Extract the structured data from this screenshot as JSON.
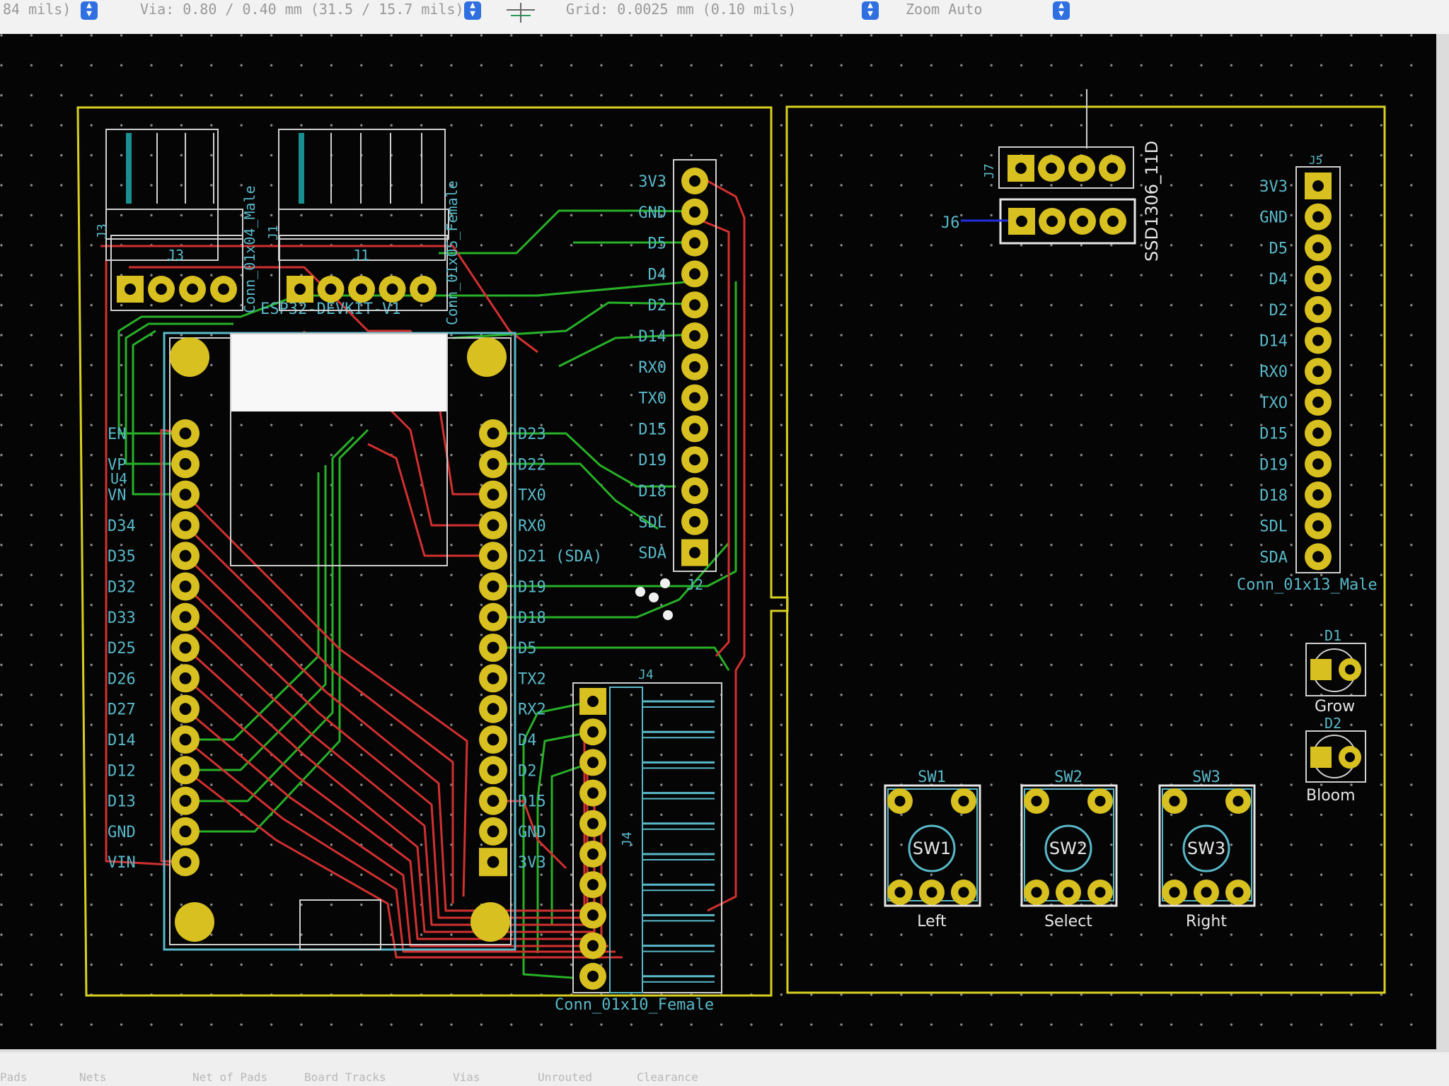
{
  "toolbar": {
    "track": "84 mils) *",
    "via": "Via: 0.80 / 0.40 mm (31.5 / 15.7 mils) *",
    "grid": "Grid: 0.0025 mm (0.10 mils)",
    "zoom": "Zoom Auto"
  },
  "board": {
    "esp32": {
      "title": "ESP32-DEVKIT-V1",
      "ref": "U4",
      "left_pins": [
        "EN",
        "VP",
        "VN",
        "D34",
        "D35",
        "D32",
        "D33",
        "D25",
        "D26",
        "D27",
        "D14",
        "D12",
        "D13",
        "GND",
        "VIN"
      ],
      "right_pins": [
        "D23",
        "D22",
        "TX0",
        "RX0",
        "D21 (SDA)",
        "D19",
        "D18",
        "D5",
        "TX2",
        "RX2",
        "D4",
        "D2",
        "D15",
        "GND",
        "3V3"
      ]
    },
    "j3": {
      "ref": "J3",
      "value": "Conn_01x04_Male"
    },
    "j1": {
      "ref": "J1",
      "value": "Conn_01x05_Female"
    },
    "j2": {
      "ref": "J2",
      "labels": [
        "3V3",
        "GND",
        "D5",
        "D4",
        "D2",
        "D14",
        "RX0",
        "TX0",
        "D15",
        "D19",
        "D18",
        "SDL",
        "SDA"
      ]
    },
    "j4": {
      "ref": "J4",
      "value": "Conn_01x10_Female"
    },
    "j5": {
      "ref": "J5",
      "value": "Conn_01x13_Male",
      "labels": [
        "3V3",
        "GND",
        "D5",
        "D4",
        "D2",
        "D14",
        "RX0",
        "TXO",
        "D15",
        "D19",
        "D18",
        "SDL",
        "SDA"
      ]
    },
    "j6": {
      "ref": "J6"
    },
    "j7": {
      "ref": "J7",
      "value": "SSD1306_11D"
    },
    "d1": {
      "ref": "D1",
      "value": "Grow"
    },
    "d2": {
      "ref": "D2",
      "value": "Bloom"
    },
    "switches": [
      {
        "ref": "SW1",
        "value": "Left"
      },
      {
        "ref": "SW2",
        "value": "Select"
      },
      {
        "ref": "SW3",
        "value": "Right"
      }
    ]
  },
  "statusbar": {
    "items": [
      "Pads",
      "Nets",
      "Net of Pads",
      "Board Tracks",
      "Vias",
      "Unrouted",
      "Clearance"
    ]
  },
  "colors": {
    "background": "#050505",
    "edge_cuts": "#d8d020",
    "silkscreen": "#59b8c8",
    "pad": "#d8c020",
    "front_copper": "#d23030",
    "back_copper": "#28b028",
    "selection": "#2030e0",
    "toolbar_accent": "#2f6fe0"
  }
}
